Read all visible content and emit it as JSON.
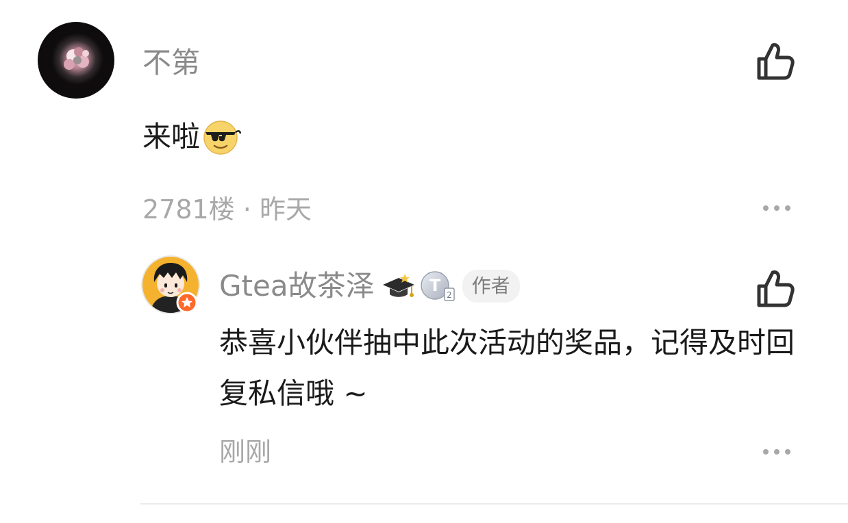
{
  "comment": {
    "username": "不第",
    "avatar": "avatar-dark-flower",
    "content": "来啦",
    "emoji": "sunglasses-emoji",
    "meta": "2781楼 · 昨天",
    "like_icon": "thumbs-up-icon",
    "more_icon": "more-dots-icon"
  },
  "reply": {
    "username": "Gtea故茶泽",
    "avatar": "avatar-cartoon-boy",
    "badges": [
      "graduation-cap-icon",
      "level-t-badge-icon"
    ],
    "author_tag": "作者",
    "content": "恭喜小伙伴抽中此次活动的奖品，记得及时回复私信哦 ~",
    "meta": "刚刚",
    "like_icon": "thumbs-up-icon",
    "more_icon": "more-dots-icon"
  },
  "colors": {
    "text_primary": "#1a1a1a",
    "text_secondary": "#8a8a8a",
    "text_meta": "#a8a8a8",
    "tag_bg": "#f2f2f2",
    "divider": "#ebebeb"
  }
}
